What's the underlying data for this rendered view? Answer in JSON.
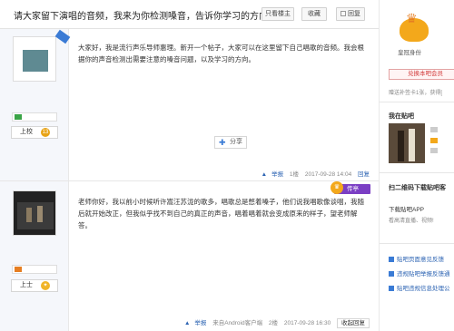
{
  "header": {
    "title": "请大家留下演唱的音频，我来为你检测嗓音，告诉你学习的方向",
    "only_author_label": "只看楼主",
    "collect_label": "收藏",
    "reply_label": "回复"
  },
  "posts": [
    {
      "level_label": "上校",
      "text": "大家好，我是流行声乐导师惠理。新开一个帖子，大家可以在这里留下自己唱歌的音频。我会根据你的声音检测出需要注意的嗓音问题，以及学习的方向。",
      "share_label": "分享",
      "report_label": "举报",
      "floor": "1楼",
      "time": "2017-09-28 14:04",
      "reply_label": "回复"
    },
    {
      "level_label": "上士",
      "text": "老师你好，我以前小时候听许嵩汪苏泷的歌多，唱歌总是憋着嗓子，他们说我唱歌像谈咽，我随后就开始改正，但我似乎找不到自己的真正的声音，唱着唱着就会变成原来的样子，望老师解答。",
      "report_label": "举报",
      "source": "来自Android客户端",
      "floor": "2楼",
      "time": "2017-09-28 16:30",
      "reply_label": "收起回复",
      "tag_label": "传亭"
    }
  ],
  "sidebar": {
    "member_label": "皇冠身份",
    "open_label": "兑换本吧会员",
    "tip": "赠送补签卡1张，获得[",
    "mybar_title": "我在贴吧",
    "qr_title": "扫二维码下载贴吧客",
    "download_label": "下载贴吧APP",
    "download_sub": "看高清直播、视频!",
    "links": [
      "贴吧页面意见反馈",
      "违规贴吧举报反馈通",
      "贴吧违规信息处理公"
    ]
  },
  "colors": {
    "accent": "#2d64b3",
    "share_blue": "#3a7bd5",
    "purple_tag": "#7b3fc4"
  }
}
